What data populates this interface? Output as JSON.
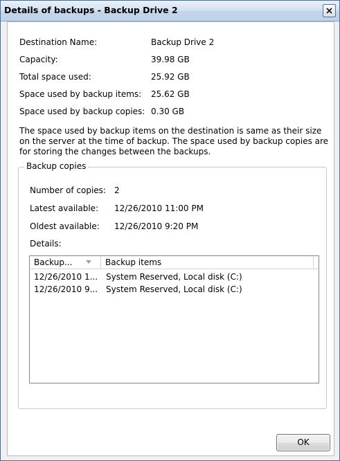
{
  "window": {
    "title": "Details of backups - Backup Drive 2"
  },
  "summary": [
    {
      "label": "Destination Name:",
      "value": "Backup Drive 2"
    },
    {
      "label": "Capacity:",
      "value": "39.98 GB"
    },
    {
      "label": "Total space used:",
      "value": "25.92 GB"
    },
    {
      "label": "Space used by backup items:",
      "value": "25.62 GB"
    },
    {
      "label": "Space used by backup copies:",
      "value": "0.30 GB"
    }
  ],
  "description": "The space used by backup items on the destination is same as their size on the server at the time of backup. The space used by backup copies are for storing the changes between the backups.",
  "backup_copies": {
    "group_title": "Backup copies",
    "number_label": "Number of copies:",
    "number_value": "2",
    "latest_label": "Latest available:",
    "latest_value": "12/26/2010 11:00 PM",
    "oldest_label": "Oldest available:",
    "oldest_value": "12/26/2010 9:20 PM",
    "details_label": "Details:",
    "columns": [
      "Backup...",
      "Backup items"
    ],
    "rows": [
      {
        "time": "12/26/2010 1...",
        "items": "System Reserved, Local disk (C:)"
      },
      {
        "time": "12/26/2010 9...",
        "items": "System Reserved, Local disk (C:)"
      }
    ]
  },
  "buttons": {
    "ok": "OK"
  }
}
